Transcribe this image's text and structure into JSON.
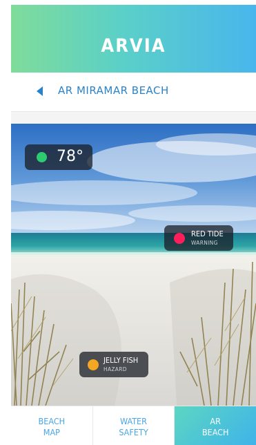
{
  "header": {
    "title": "ARVIA"
  },
  "nav": {
    "location": "AR MIRAMAR BEACH"
  },
  "overlays": {
    "temperature": {
      "value": "78°",
      "status_color": "#2ecc71"
    },
    "red_tide": {
      "title": "RED TIDE",
      "subtitle": "WARNING",
      "status_color": "#ff1e5a"
    },
    "jelly_fish": {
      "title": "JELLY FISH",
      "subtitle": "HAZARD",
      "status_color": "#f5a623"
    }
  },
  "tabs": [
    {
      "line1": "BEACH",
      "line2": "MAP",
      "active": false
    },
    {
      "line1": "WATER",
      "line2": "SAFETY",
      "active": false
    },
    {
      "line1": "AR",
      "line2": "BEACH",
      "active": true
    }
  ],
  "colors": {
    "accent": "#2a83c9",
    "header_start": "#7fdc9a",
    "header_end": "#48b6ec"
  }
}
